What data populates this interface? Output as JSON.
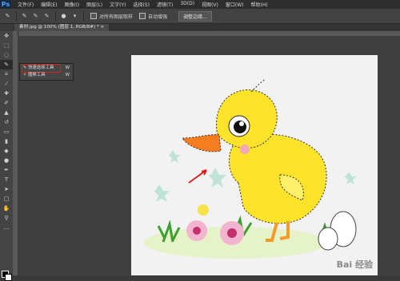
{
  "app": {
    "logo": "Ps"
  },
  "menu": [
    "文件(F)",
    "编辑(E)",
    "图像(I)",
    "图层(L)",
    "文字(Y)",
    "选择(S)",
    "滤镜(T)",
    "3D(D)",
    "视图(V)",
    "窗口(W)",
    "帮助(H)"
  ],
  "options": {
    "sample_all_layers_label": "对所有图层取样",
    "auto_enhance_label": "自动增强",
    "refine_edge_label": "调整边缘..."
  },
  "document": {
    "tab_title": "素材.jpg @ 100% (图层 1, RGB/8#) * ×"
  },
  "flyout": {
    "items": [
      {
        "label": "快速选择工具",
        "key": "W"
      },
      {
        "label": "魔棒工具",
        "key": "W"
      }
    ]
  },
  "watermark": "Bai 经验",
  "colors": {
    "accent_red": "#e02020",
    "duck_yellow": "#ffe22a",
    "beak_orange": "#f57c1f"
  }
}
